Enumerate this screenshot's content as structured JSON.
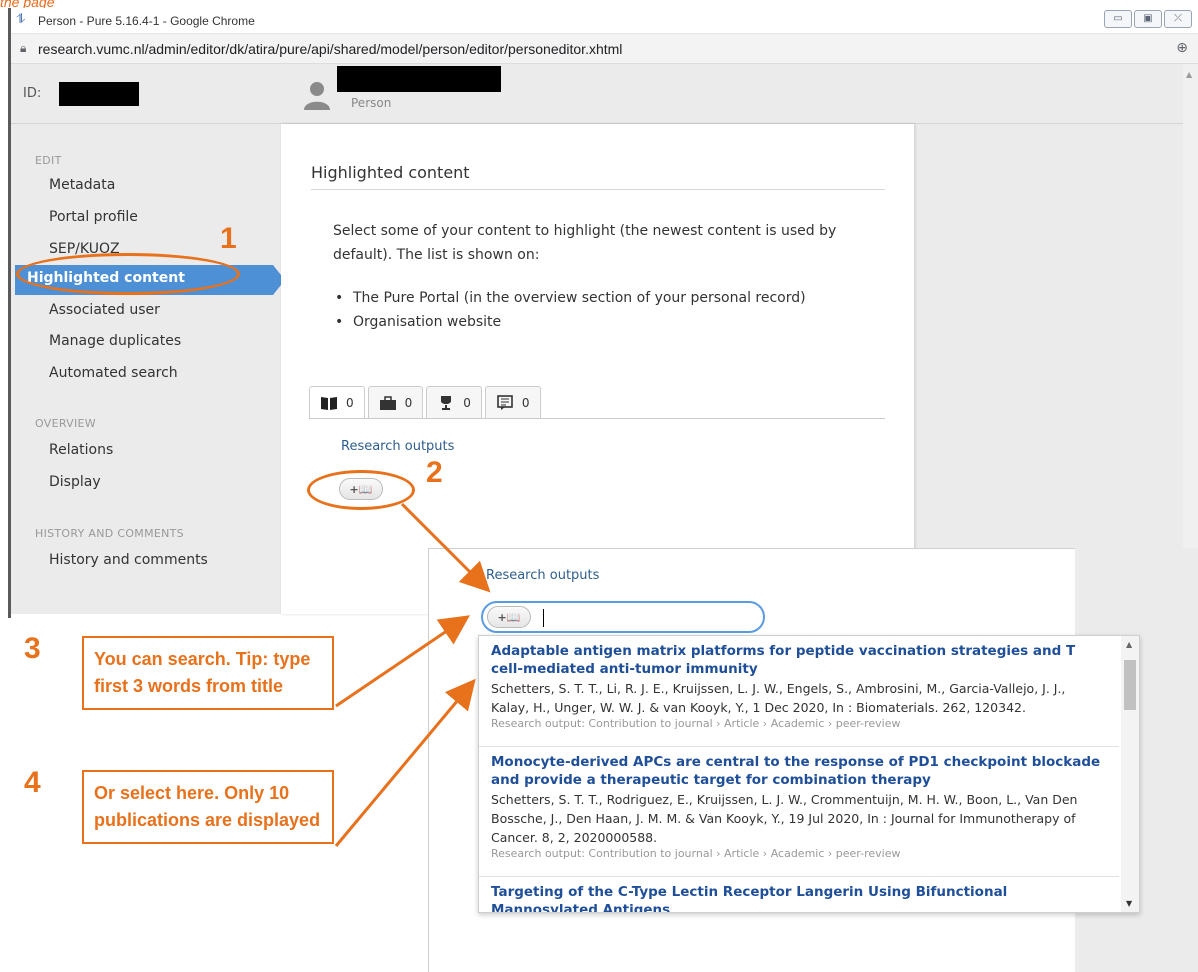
{
  "caption": "the page",
  "browser": {
    "title": "Person - Pure 5.16.4-1 - Google Chrome",
    "url": "research.vumc.nl/admin/editor/dk/atira/pure/api/shared/model/person/editor/personeditor.xhtml",
    "window_controls": [
      "▭",
      "▣",
      "⤫"
    ]
  },
  "header": {
    "id_label": "ID:",
    "person_label": "Person"
  },
  "sidebar": {
    "edit_title": "EDIT",
    "edit_items": [
      "Metadata",
      "Portal profile",
      "SEP/KUOZ",
      "Highlighted content",
      "Associated user",
      "Manage duplicates",
      "Automated search"
    ],
    "overview_title": "OVERVIEW",
    "overview_items": [
      "Relations",
      "Display"
    ],
    "history_title": "HISTORY AND COMMENTS",
    "history_items": [
      "History and comments"
    ]
  },
  "main": {
    "heading": "Highlighted content",
    "intro": "Select some of your content to highlight (the newest content is used by default). The list is shown on:",
    "bullets": [
      "The Pure Portal (in the overview section of your personal record)",
      "Organisation website"
    ],
    "tabs": [
      {
        "icon": "book-icon",
        "count": "0"
      },
      {
        "icon": "briefcase-icon",
        "count": "0"
      },
      {
        "icon": "trophy-icon",
        "count": "0"
      },
      {
        "icon": "comment-icon",
        "count": "0"
      }
    ],
    "section_label": "Research outputs",
    "add_button_label": "+📖"
  },
  "annotations": {
    "n1": "1",
    "n2": "2",
    "n3": "3",
    "n4": "4"
  },
  "zoom": {
    "section_label": "Research outputs",
    "add_button_label": "+📖",
    "search_value": "",
    "results": [
      {
        "title": "Adaptable antigen matrix platforms for peptide vaccination strategies and T cell-mediated anti-tumor immunity",
        "authors": "Schetters, S. T. T., Li, R. J. E., Kruijssen, L. J. W., Engels, S., Ambrosini, M., Garcia-Vallejo, J. J., Kalay, H., Unger, W. W. J. & van Kooyk, Y., 1 Dec 2020, In : Biomaterials. 262, 120342.",
        "type": "Research output: Contribution to journal › Article › Academic › peer-review"
      },
      {
        "title": "Monocyte-derived APCs are central to the response of PD1 checkpoint blockade and provide a therapeutic target for combination therapy",
        "authors": "Schetters, S. T. T., Rodriguez, E., Kruijssen, L. J. W., Crommentuijn, M. H. W., Boon, L., Van Den Bossche, J., Den Haan, J. M. M. & Van Kooyk, Y., 19 Jul 2020, In : Journal for Immunotherapy of Cancer. 8, 2, 2020000588.",
        "type": "Research output: Contribution to journal › Article › Academic › peer-review"
      },
      {
        "title": "Targeting of the C-Type Lectin Receptor Langerin Using Bifunctional Mannosylated Antigens",
        "authors": "",
        "type": ""
      }
    ]
  },
  "tips": {
    "tip3": "You can search. Tip: type first 3 words from title",
    "tip4": "Or select here. Only 10 publications are displayed"
  },
  "colors": {
    "accent": "#e8711c",
    "active_nav": "#4d90d6",
    "link": "#1f4f98"
  }
}
